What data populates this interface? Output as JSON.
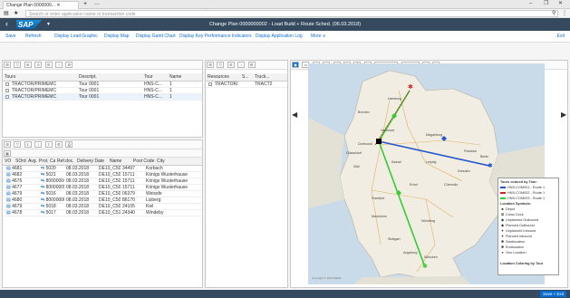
{
  "browser": {
    "tab_title": "Change Plan 0000000...",
    "tab_add": "+",
    "tab_more": "...",
    "window_controls": [
      "–",
      "❐",
      "✕"
    ],
    "search_placeholder": "Search or enter application name or transaction code"
  },
  "shell": {
    "logo": "SAP",
    "title": "Change Plan 0000000002 - Load Build + Route Sched. (06.03.2018)"
  },
  "toolbar": {
    "items": [
      "Save",
      "Refresh",
      "Display Load Graphic",
      "Display Map",
      "Display Gantt Chart",
      "Display Key Performance Indicators",
      "Display Application Log",
      "More ∨"
    ],
    "exit": "Exit"
  },
  "tours_grid": {
    "headers": [
      "Tours",
      "Descript.",
      "Tour",
      "Name"
    ],
    "rows": [
      [
        "TRACTOR/PRIMEMC",
        "Tour 0001",
        "HNS-C...",
        "1"
      ],
      [
        "TRACTOR/PRIMEMC",
        "Tour 0001",
        "HNS-C...",
        "1"
      ],
      [
        "TRACTOR/PRIMEMC",
        "Tour 0001",
        "HNS-C...",
        "1"
      ]
    ]
  },
  "orders_grid": {
    "headers": [
      "VO",
      "SOrd.",
      "Avg.",
      "Prot.",
      "Cat",
      "Ref.doc.",
      "Delivery Date",
      "Name",
      "Post Code",
      "City"
    ],
    "rows": [
      [
        "4681",
        "5020",
        "08.03.2018",
        "DE10_C501",
        "34497",
        "Korbach"
      ],
      [
        "4682",
        "5021",
        "08.03.2018",
        "DE10_C502",
        "15711",
        "Königs Wusterhause"
      ],
      [
        "4676",
        "80000004",
        "08.03.2018",
        "DE10_C502",
        "15711",
        "Königs Wusterhause"
      ],
      [
        "4677",
        "80000005",
        "08.03.2018",
        "DE10_C502",
        "15711",
        "Königs Wusterhause"
      ],
      [
        "4679",
        "5016",
        "08.03.2018",
        "DE10_C504",
        "06379",
        "Weissfe"
      ],
      [
        "4680",
        "80000006",
        "08.03.2018",
        "DE10_C505",
        "86170",
        "Lisberg"
      ],
      [
        "4679",
        "5018",
        "08.03.2018",
        "DE10_C506",
        "24105",
        "Kiel"
      ],
      [
        "4678",
        "5017",
        "08.03.2018",
        "DE10_C510",
        "24340",
        "Windeby"
      ]
    ]
  },
  "resources_grid": {
    "headers": [
      "Resources",
      "S...",
      "Truck..."
    ],
    "rows": [
      [
        "TRACTOR/",
        "TRACT2"
      ]
    ]
  },
  "map": {
    "toolbar_labels": [
      "Locations",
      "Tours"
    ],
    "cities": [
      "Hamburg",
      "Bremen",
      "Berlin",
      "Hannover",
      "Leipzig",
      "Dresden",
      "Erfurt",
      "Frankfurt",
      "Nürnberg",
      "Stuttgart",
      "München",
      "Köln",
      "Düsseldorf",
      "Dortmund",
      "Kassel",
      "Magdeburg",
      "Potsdam",
      "Chemnitz",
      "Mannheim",
      "Augsburg"
    ],
    "copyright": "Copyright © 2018 HERE"
  },
  "legend": {
    "title": "Tours colored by Tour:",
    "tours": [
      {
        "label": "HNS-COM001 - Route 1",
        "color": "#2255cc"
      },
      {
        "label": "HNS-COM002 - Route 1",
        "color": "#d02020"
      },
      {
        "label": "HNS-COM003 - Route 1",
        "color": "#33cc33"
      }
    ],
    "symbols_title": "Location Symbols:",
    "symbols": [
      {
        "icon": "■",
        "label": "Depot"
      },
      {
        "icon": "⊠",
        "label": "Cross Dock"
      },
      {
        "icon": "◆",
        "label": "Unplanned Outbound"
      },
      {
        "icon": "◆",
        "label": "Planned Outbound"
      },
      {
        "icon": "▼",
        "label": "Unplanned Inbound"
      },
      {
        "icon": "▼",
        "label": "Planned Inbound"
      },
      {
        "icon": "✱",
        "label": "Startlocation"
      },
      {
        "icon": "✱",
        "label": "Endlocation"
      },
      {
        "icon": "●",
        "label": "Geo Location"
      }
    ],
    "footer": "Location Coloring by Tour"
  },
  "footer": {
    "save_exit": "Save + Exit"
  }
}
